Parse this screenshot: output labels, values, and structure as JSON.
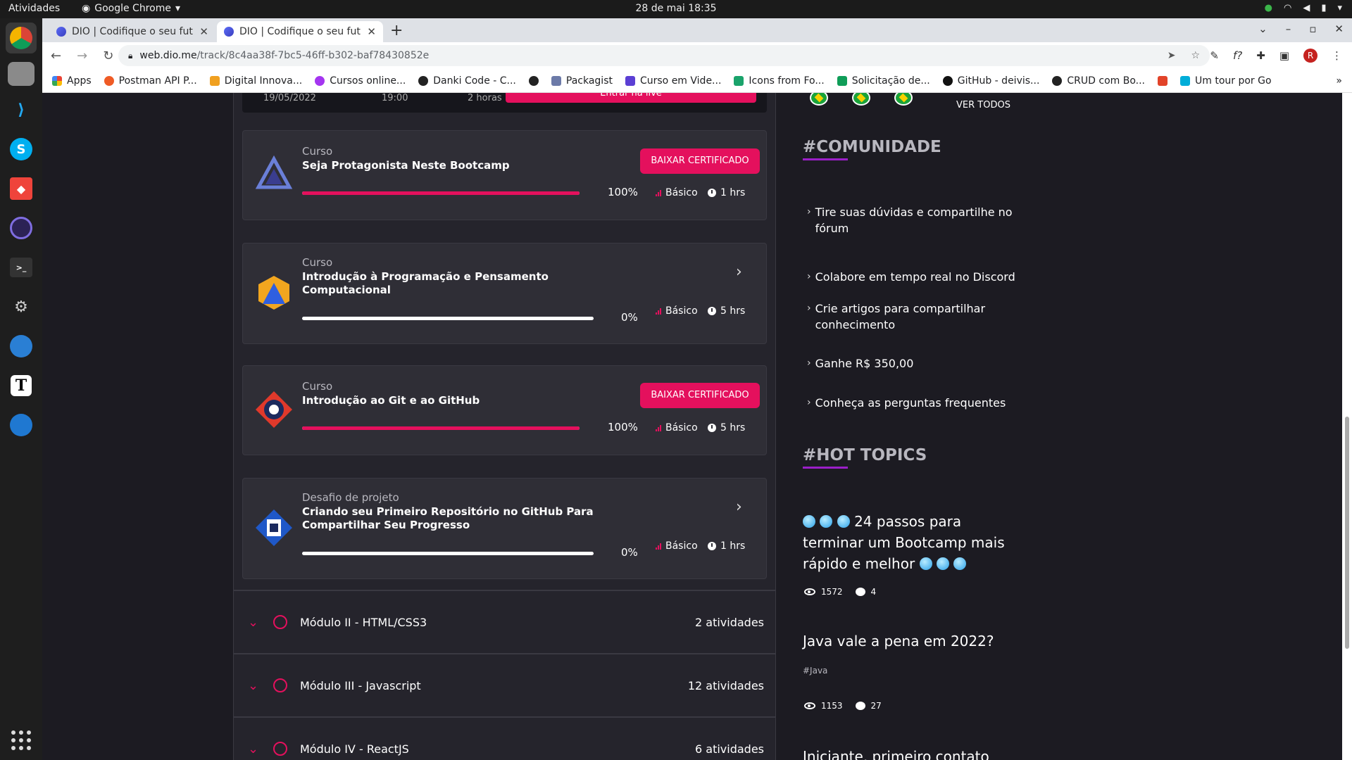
{
  "os": {
    "activities": "Atividades",
    "app_name": "Google Chrome",
    "clock": "28 de mai  18:35"
  },
  "browser": {
    "tabs": [
      {
        "title": "DIO | Codifique o seu futu"
      },
      {
        "title": "DIO | Codifique o seu futu"
      }
    ],
    "url_domain": "web.dio.me",
    "url_path": "/track/8c4aa38f-7bc5-46ff-b302-baf78430852e",
    "avatar_letter": "R",
    "bookmarks": [
      "Apps",
      "Postman API P...",
      "Digital Innova...",
      "Cursos online...",
      "Danki Code - C...",
      "",
      "Packagist",
      "Curso em Vide...",
      "Icons from Fo...",
      "Solicitação de...",
      "GitHub - deivis...",
      "CRUD com Bo...",
      "",
      "Um tour por Go"
    ]
  },
  "live": {
    "date": "19/05/2022",
    "time": "19:00",
    "duration": "2 horas",
    "button": "Entrar na live"
  },
  "cards": [
    {
      "type": "Curso",
      "name": "Seja Protagonista Neste Bootcamp",
      "progress": 100,
      "progress_label": "100%",
      "level": "Básico",
      "hours": "1 hrs",
      "action": "BAIXAR CERTIFICADO"
    },
    {
      "type": "Curso",
      "name": "Introdução à Programação e Pensamento Computacional",
      "progress": 0,
      "progress_label": "0%",
      "level": "Básico",
      "hours": "5 hrs"
    },
    {
      "type": "Curso",
      "name": "Introdução ao Git e ao GitHub",
      "progress": 100,
      "progress_label": "100%",
      "level": "Básico",
      "hours": "5 hrs",
      "action": "BAIXAR CERTIFICADO"
    },
    {
      "type": "Desafio de projeto",
      "name": "Criando seu Primeiro Repositório no GitHub Para Compartilhar Seu Progresso",
      "progress": 0,
      "progress_label": "0%",
      "level": "Básico",
      "hours": "1 hrs"
    }
  ],
  "modules": [
    {
      "title": "Módulo II - HTML/CSS3",
      "count": "2 atividades"
    },
    {
      "title": "Módulo III - Javascript",
      "count": "12 atividades"
    },
    {
      "title": "Módulo IV - ReactJS",
      "count": "6 atividades"
    }
  ],
  "sidebar": {
    "ver_todos": "VER TODOS",
    "community_title": "#COMUNIDADE",
    "community_links": [
      "Tire suas dúvidas e compartilhe no fórum",
      "Colabore em tempo real no Discord",
      "Crie artigos para compartilhar conhecimento",
      "Ganhe R$ 350,00",
      "Conheça as perguntas frequentes"
    ],
    "hot_title": "#HOT TOPICS",
    "topics": [
      {
        "title": "24 passos para terminar um Bootcamp mais rápido e melhor",
        "tag": "",
        "views": "1572",
        "comments": "4"
      },
      {
        "title": "Java vale a pena em 2022?",
        "tag": "#Java",
        "views": "1153",
        "comments": "27"
      },
      {
        "title": "Iniciante, primeiro contato"
      }
    ]
  },
  "colors": {
    "accent": "#e4105d",
    "purple": "#9b1fc8",
    "bg": "#1c1b22",
    "card": "#2f2e36"
  }
}
